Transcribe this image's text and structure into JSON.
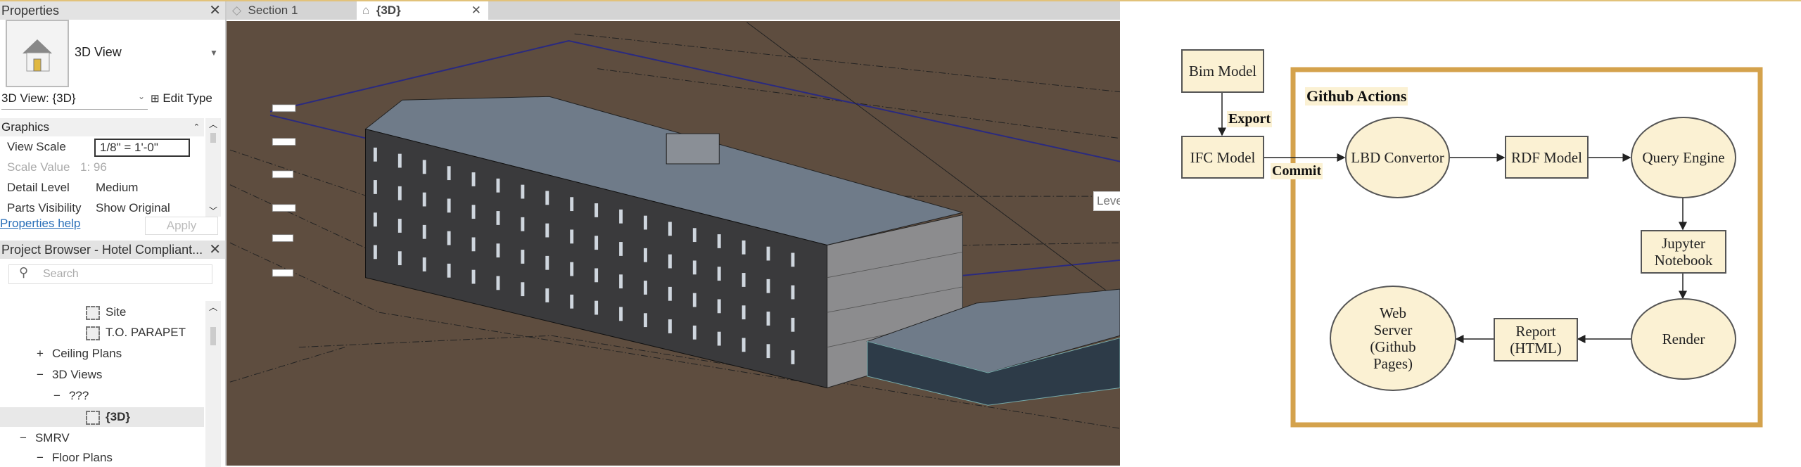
{
  "properties": {
    "title": "Properties",
    "type_name": "3D View",
    "instance": "3D View: {3D}",
    "edit_type": "Edit Type",
    "group": "Graphics",
    "rows": [
      {
        "k": "View Scale",
        "v": "1/8\" = 1'-0\""
      },
      {
        "k": "Scale Value",
        "v": "1: 96"
      },
      {
        "k": "Detail Level",
        "v": "Medium"
      },
      {
        "k": "Parts Visibility",
        "v": "Show Original"
      }
    ],
    "help": "Properties help",
    "apply": "Apply"
  },
  "browser": {
    "title": "Project Browser - Hotel Compliant...",
    "search_placeholder": "Search",
    "items": [
      "Site",
      "T.O. PARAPET",
      "Ceiling Plans",
      "3D Views",
      "???",
      "{3D}",
      "SMRV",
      "Floor Plans"
    ]
  },
  "tabs": [
    {
      "label": "Section 1"
    },
    {
      "label": "{3D}"
    }
  ],
  "viewport": {
    "tooltip": "Leve",
    "background": "#5e4d3f"
  },
  "diagram": {
    "frame_label": "Github Actions",
    "frame_color": "#d4a24c",
    "node_fill": "#fbf1d3",
    "nodes": {
      "bim": "Bim Model",
      "ifc": "IFC Model",
      "lbd": "LBD Convertor",
      "rdf": "RDF Model",
      "query": "Query Engine",
      "jupyter": "Jupyter Notebook",
      "render": "Render",
      "report": "Report (HTML)",
      "web": "Web Server (Github Pages)"
    },
    "edges": {
      "export": "Export",
      "commit": "Commit"
    }
  }
}
